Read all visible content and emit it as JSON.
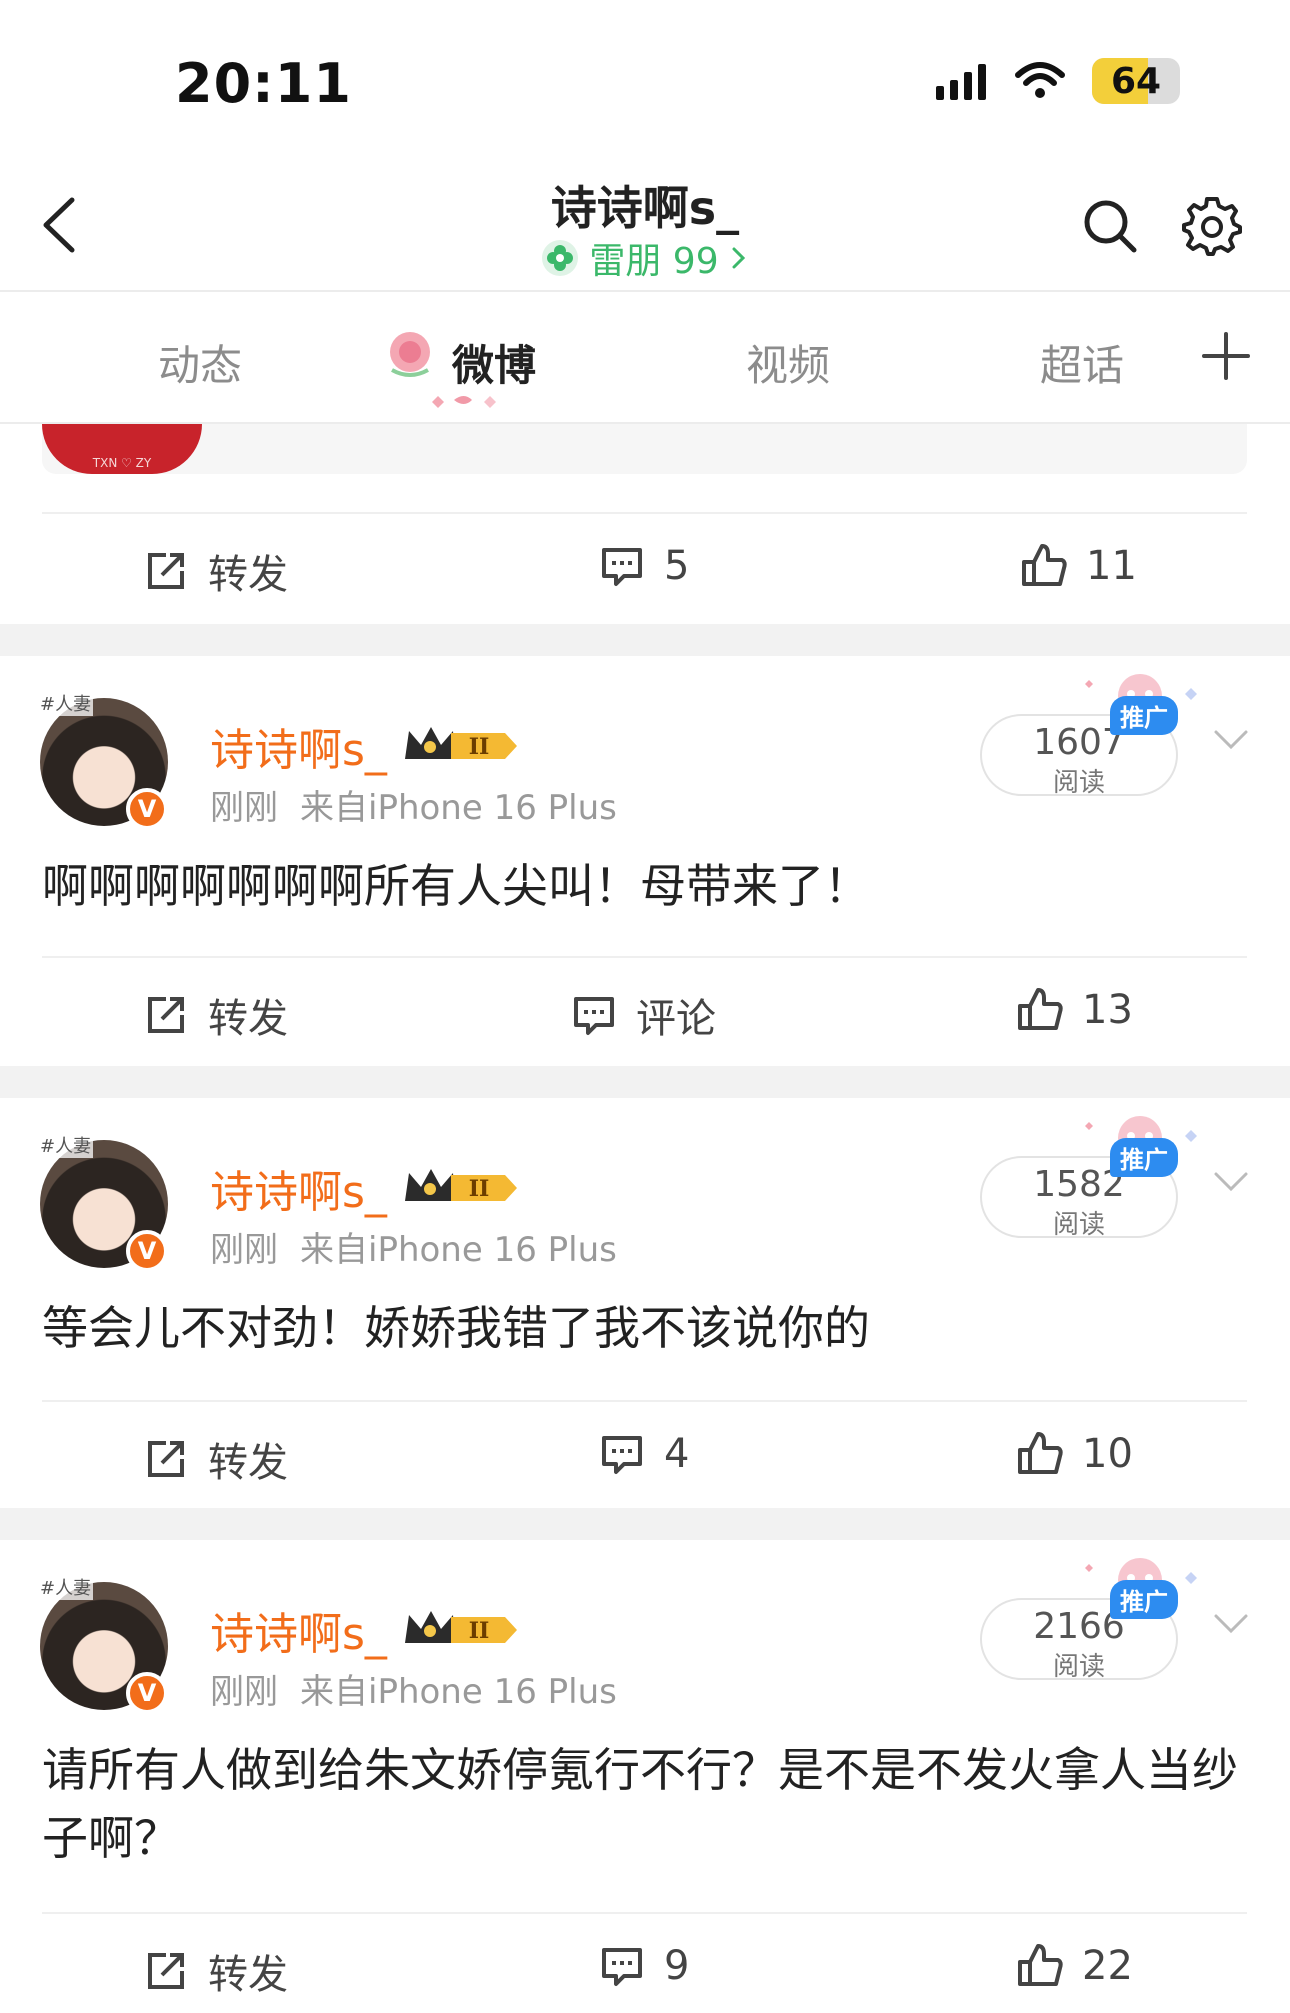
{
  "status_bar": {
    "time": "20:11",
    "battery": "64",
    "battery_level": 0.64,
    "battery_color": "#f3cf3a"
  },
  "header": {
    "name": "诗诗啊s_",
    "rank": "雷朋 99",
    "rank_color": "#3bb86a"
  },
  "tabs": [
    {
      "label": "动态",
      "active": false
    },
    {
      "label": "微博",
      "active": true
    },
    {
      "label": "视频",
      "active": false
    },
    {
      "label": "超话",
      "active": false
    }
  ],
  "partial_post": {
    "image_text": "TXN ♡ ZY",
    "repost": "转发",
    "comments": "5",
    "likes": "11"
  },
  "posts": [
    {
      "author": "诗诗啊s_",
      "avatar_tag": "#人妻",
      "time": "刚刚",
      "source": "来自iPhone 16 Plus",
      "reads": "1607",
      "reads_label": "阅读",
      "promo": "推广",
      "text": "啊啊啊啊啊啊啊所有人尖叫！母带来了！",
      "repost": "转发",
      "comment": "评论",
      "likes": "13"
    },
    {
      "author": "诗诗啊s_",
      "avatar_tag": "#人妻",
      "time": "刚刚",
      "source": "来自iPhone 16 Plus",
      "reads": "1582",
      "reads_label": "阅读",
      "promo": "推广",
      "text": "等会儿不对劲！娇娇我错了我不该说你的",
      "repost": "转发",
      "comment": "4",
      "likes": "10"
    },
    {
      "author": "诗诗啊s_",
      "avatar_tag": "#人妻",
      "time": "刚刚",
      "source": "来自iPhone 16 Plus",
      "reads": "2166",
      "reads_label": "阅读",
      "promo": "推广",
      "text": "请所有人做到给朱文娇停氪行不行？是不是不发火拿人当纱子啊？",
      "repost": "转发",
      "comment": "9",
      "likes": "22"
    }
  ],
  "colors": {
    "accent": "#f26d1a",
    "verified": "#f26d1a",
    "promo": "#2d8cf0"
  },
  "icons": {
    "back": "chevron-left-icon",
    "search": "search-icon",
    "settings": "gear-icon",
    "add": "plus-icon",
    "repost": "share-icon",
    "comment": "comment-icon",
    "like": "thumbs-up-icon",
    "more": "chevron-down-icon"
  }
}
